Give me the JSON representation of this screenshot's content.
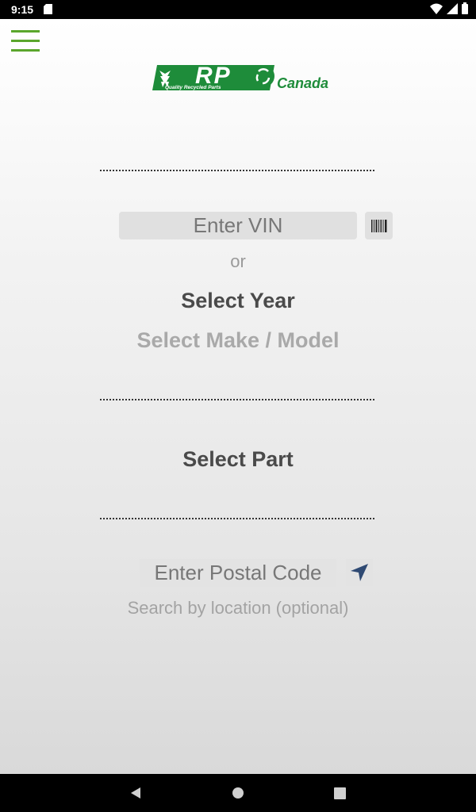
{
  "status_bar": {
    "time": "9:15"
  },
  "logo": {
    "text": "QRP",
    "tagline": "Quality Recycled Parts",
    "region": "Canada"
  },
  "vin": {
    "placeholder": "Enter VIN"
  },
  "or_label": "or",
  "vehicle": {
    "year_label": "Select Year",
    "make_model_label": "Select Make / Model"
  },
  "part": {
    "label": "Select Part"
  },
  "location": {
    "placeholder": "Enter Postal Code",
    "hint": "Search by location (optional)"
  },
  "colors": {
    "brand_green": "#1e8c3a",
    "menu_green": "#5aa62c",
    "location_icon": "#2f4a73"
  }
}
